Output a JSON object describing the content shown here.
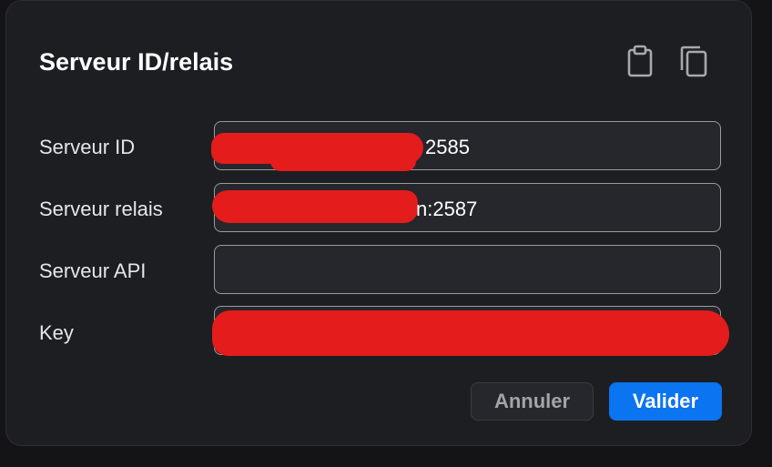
{
  "dialog": {
    "title": "Serveur ID/relais",
    "icons": {
      "paste": "clipboard-icon",
      "copy": "copy-icon"
    }
  },
  "fields": {
    "id_server": {
      "label": "Serveur ID",
      "value_visible": "2585"
    },
    "relay_server": {
      "label": "Serveur relais",
      "value_visible": "n:2587"
    },
    "api_server": {
      "label": "Serveur API",
      "value": ""
    },
    "key": {
      "label": "Key",
      "value": ""
    }
  },
  "buttons": {
    "cancel_label": "Annuler",
    "ok_label": "Valider"
  },
  "colors": {
    "accent": "#0b74f0",
    "redaction": "#e41c1c",
    "dialog_bg": "#1d1e22"
  }
}
